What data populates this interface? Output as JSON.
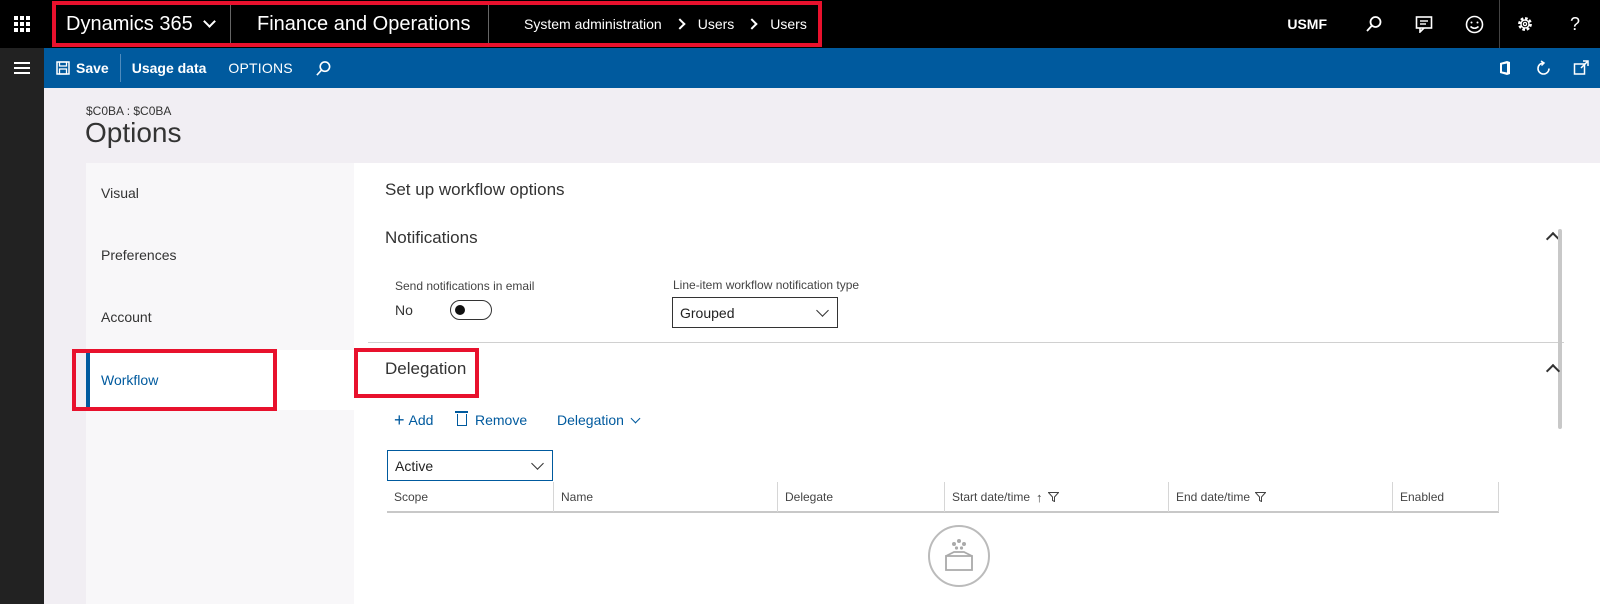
{
  "topbar": {
    "product": "Dynamics 365",
    "app": "Finance and Operations",
    "breadcrumbs": [
      "System administration",
      "Users",
      "Users"
    ],
    "company": "USMF",
    "help": "?"
  },
  "actionbar": {
    "save": "Save",
    "usage_data": "Usage data",
    "options": "OPTIONS"
  },
  "page": {
    "company_path": "$C0BA : $C0BA",
    "title": "Options"
  },
  "tabs": [
    {
      "label": "Visual"
    },
    {
      "label": "Preferences"
    },
    {
      "label": "Account"
    },
    {
      "label": "Workflow",
      "active": true
    }
  ],
  "content": {
    "title": "Set up workflow options",
    "notifications": {
      "title": "Notifications",
      "send_email_label": "Send notifications in email",
      "send_email_value": "No",
      "line_item_label": "Line-item workflow notification type",
      "line_item_value": "Grouped"
    },
    "delegation": {
      "title": "Delegation",
      "add": "Add",
      "remove": "Remove",
      "delegation_menu": "Delegation",
      "filter_value": "Active",
      "columns": [
        "Scope",
        "Name",
        "Delegate",
        "Start date/time",
        "End date/time",
        "Enabled"
      ],
      "sort_indicator": "↑"
    }
  },
  "colors": {
    "topbar": "#000000",
    "actionbar": "#005a9e",
    "accent": "#005a9e",
    "highlight": "#e8112d"
  },
  "icons": [
    "waffle-icon",
    "chevron-down-icon",
    "search-icon",
    "chat-icon",
    "smiley-icon",
    "gear-icon",
    "help-icon",
    "hamburger-icon",
    "save-icon",
    "office-icon",
    "refresh-icon",
    "popout-icon",
    "filter-icon",
    "trash-icon",
    "plus-icon",
    "empty-folder-icon"
  ]
}
